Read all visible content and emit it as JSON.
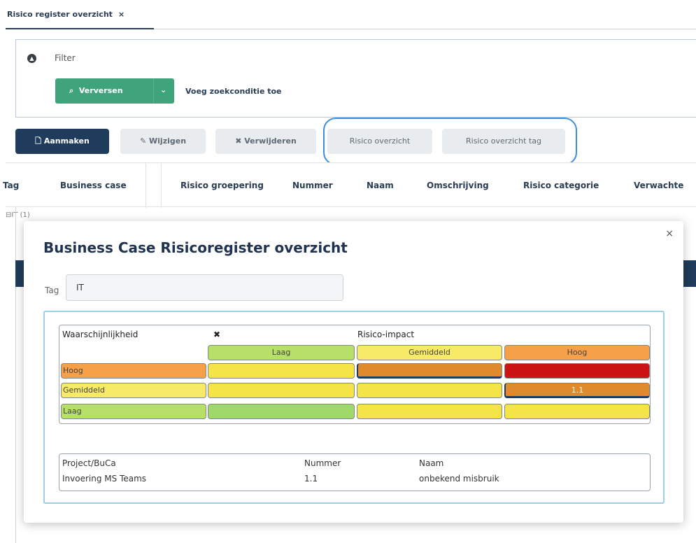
{
  "tab": {
    "title": "Risico register overzicht",
    "close": "×"
  },
  "filter": {
    "label": "Filter",
    "refresh_label": "Verversen",
    "add_condition": "Voeg zoekconditie toe"
  },
  "toolbar": {
    "create": "Aanmaken",
    "edit": "Wijzigen",
    "delete": "Verwijderen",
    "risk_overview": "Risico overzicht",
    "risk_overview_tag": "Risico overzicht tag"
  },
  "grid": {
    "columns": [
      "Tag",
      "Business case",
      "Risico groepering",
      "Nummer",
      "Naam",
      "Omschrijving",
      "Risico categorie",
      "Verwachte"
    ],
    "group_row": "IT (1)"
  },
  "modal": {
    "title": "Business Case Risicoregister overzicht",
    "close": "×",
    "tag_label": "Tag",
    "tag_value": "IT",
    "matrix": {
      "likelihood_label": "Waarschijnlijkheid",
      "clear_icon": "✖",
      "impact_label": "Risico-impact",
      "impact_levels": [
        "Laag",
        "Gemiddeld",
        "Hoog"
      ],
      "likelihood_levels": [
        "Hoog",
        "Gemiddeld",
        "Laag"
      ],
      "cells": [
        [
          "",
          "",
          ""
        ],
        [
          "",
          "",
          "1.1"
        ],
        [
          "",
          "",
          ""
        ]
      ],
      "colors": {
        "impact_header": [
          "#b7e069",
          "#f7ea66",
          "#f6a04a"
        ],
        "likelihood_header": [
          "#f6a04a",
          "#f7ea66",
          "#b7e069"
        ],
        "grid": [
          [
            "#f5e447",
            "#df8a2c",
            "#cc1414"
          ],
          [
            "#f5e447",
            "#f5e447",
            "#df8a2c"
          ],
          [
            "#9fd96b",
            "#f5e447",
            "#f5e447"
          ]
        ]
      }
    },
    "list": {
      "headers": [
        "Project/BuCa",
        "Nummer",
        "Naam"
      ],
      "rows": [
        [
          "Invoering MS Teams",
          "1.1",
          "onbekend misbruik"
        ]
      ]
    }
  },
  "colors": {
    "accent": "#1f3c5c",
    "refresh": "#3fa37c",
    "highlight": "#3d8fe0"
  }
}
